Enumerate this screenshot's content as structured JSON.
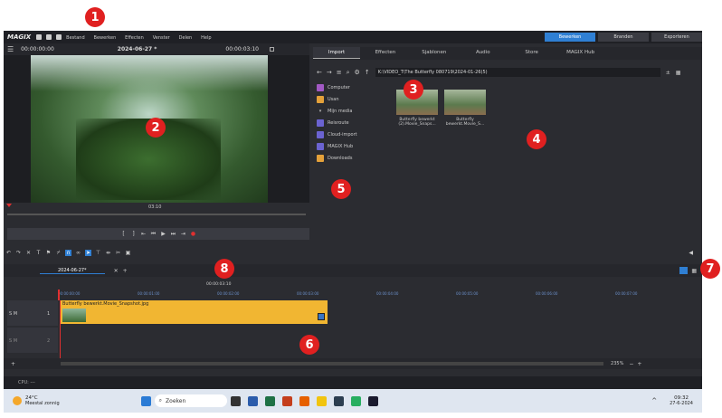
{
  "app": {
    "logo": "MAGIX"
  },
  "menu": [
    "Bestand",
    "Bewerken",
    "Effecten",
    "Venster",
    "Delen",
    "Help"
  ],
  "modes": [
    "Bewerken",
    "Branden",
    "Exporteren"
  ],
  "preview": {
    "tc_start": "00:00:00:00",
    "title": "2024-06-27 *",
    "tc_end": "00:00:03:10",
    "mini_time": "03:10"
  },
  "media_tabs": [
    "Import",
    "Effecten",
    "Sjablonen",
    "Audio",
    "Store",
    "MAGIX Hub"
  ],
  "path": "K:\\VIDEO_T\\The Butterfly 080719\\2024-01-26(5)",
  "sources": [
    "Computer",
    "Usan",
    "Mijn media",
    "Reisroute",
    "Cloud-import",
    "MAGIX Hub",
    "Downloads"
  ],
  "files": [
    {
      "name": "Butterfly bewerkt (2).Movie_Snaps..."
    },
    {
      "name": "Butterfly bewerkt.Movie_S..."
    }
  ],
  "timeline": {
    "tab": "2024-06-27*",
    "ruler_tc": "00:00:03:10",
    "clip": "Butterfly bewerkt.Movie_Snapshot.jpg",
    "zoom": "235%",
    "ticks": [
      "00:00:00:00",
      "00:00:01:00",
      "00:00:02:00",
      "00:00:03:00",
      "00:00:04:00",
      "00:00:05:00",
      "00:00:06:00",
      "00:00:07:00"
    ],
    "track1": "1",
    "track2": "2",
    "track_label": "S M"
  },
  "status": {
    "cpu": "CPU: ---"
  },
  "taskbar": {
    "temp": "24°C",
    "weather": "Meestal zonnig",
    "search": "Zoeken",
    "time": "09:32",
    "date": "27-6-2024"
  },
  "markers": [
    "1",
    "2",
    "3",
    "4",
    "5",
    "6",
    "7",
    "8"
  ],
  "colors": {
    "accent": "#2f7fd3",
    "clip": "#f1b632",
    "marker": "#e02020",
    "record": "#e03030"
  }
}
